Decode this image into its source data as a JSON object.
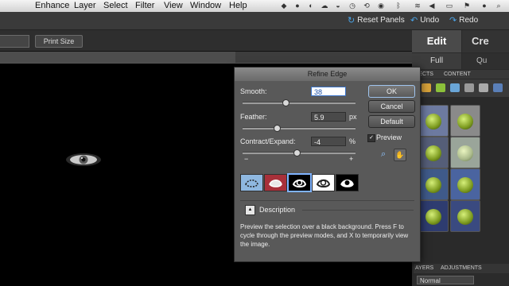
{
  "menubar": {
    "items": [
      "Enhance",
      "Layer",
      "Select",
      "Filter",
      "View",
      "Window",
      "Help"
    ]
  },
  "apptoolbar": {
    "reset_panels": "Reset Panels",
    "undo": "Undo",
    "redo": "Redo"
  },
  "optionsbar": {
    "print_size": "Print Size"
  },
  "panel": {
    "tab_edit": "Edit",
    "tab_create": "Cre",
    "sub_full": "Full",
    "sub_quick": "Qu",
    "effects_tab": "FECTS",
    "content_tab": "CONTENT",
    "layers_tab": "AYERS",
    "adjustments_tab": "ADJUSTMENTS",
    "blend_mode": "Normal"
  },
  "dialog": {
    "title": "Refine Edge",
    "smooth_label": "Smooth:",
    "smooth_value": "38",
    "feather_label": "Feather:",
    "feather_value": "5.9",
    "feather_unit": "px",
    "contract_label": "Contract/Expand:",
    "contract_value": "-4",
    "contract_unit": "%",
    "minus": "−",
    "plus": "+",
    "ok": "OK",
    "cancel": "Cancel",
    "default": "Default",
    "preview": "Preview",
    "description_label": "Description",
    "description_text": "Preview the selection over a black background. Press F to cycle through the preview modes, and X to temporarily view the image.",
    "smooth_level": 0.38,
    "feather_level": 0.3,
    "contract_level": 0.48,
    "selected_mode": 2
  },
  "colors": {
    "accent": "#4aa3e6",
    "dialog_bg": "#595959",
    "canvas_bg": "#000000"
  }
}
